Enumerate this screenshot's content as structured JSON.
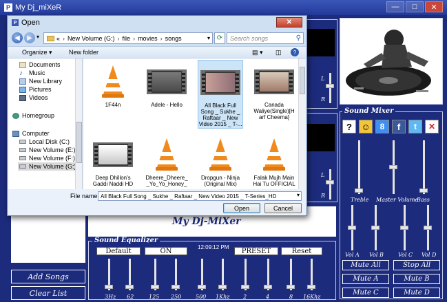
{
  "app": {
    "title": "My Dj_miXeR",
    "icon_letter": "P",
    "brand_text": "My Dj-MiXer"
  },
  "window_buttons": {
    "minimize": "—",
    "maximize": "□",
    "close": "✕"
  },
  "dialog": {
    "title": "Open",
    "icon_letter": "P",
    "close": "✕",
    "breadcrumb": [
      "«",
      "New Volume (G:)",
      "file",
      "movies",
      "songs"
    ],
    "search_placeholder": "Search songs",
    "toolbar": {
      "organize": "Organize ▾",
      "new_folder": "New folder"
    },
    "nav_items": [
      {
        "label": "Documents",
        "icon": "documents-icon"
      },
      {
        "label": "Music",
        "icon": "music-icon"
      },
      {
        "label": "New Library",
        "icon": "library-icon"
      },
      {
        "label": "Pictures",
        "icon": "pictures-icon"
      },
      {
        "label": "Videos",
        "icon": "videos-icon"
      },
      {
        "label": "Homegroup",
        "icon": "homegroup-icon"
      },
      {
        "label": "Computer",
        "icon": "computer-icon"
      },
      {
        "label": "Local Disk (C:)",
        "icon": "drive-icon"
      },
      {
        "label": "New Volume (E:)",
        "icon": "drive-icon"
      },
      {
        "label": "New Volume (F:)",
        "icon": "drive-icon"
      },
      {
        "label": "New Volume (G:)",
        "icon": "drive-icon"
      }
    ],
    "files": [
      {
        "name": "1F44n",
        "kind": "vlc"
      },
      {
        "name": "Adele - Hello",
        "kind": "video"
      },
      {
        "name": "All Black Full Song _ Sukhe _ Raftaar _ New Video 2015 _ T-...",
        "kind": "video"
      },
      {
        "name": "Canada Waliye(Single)[H arf Cheema]",
        "kind": "video"
      },
      {
        "name": "Deep Dhillon's Gaddi Naddi HD",
        "kind": "video"
      },
      {
        "name": "Dheere_Dheere_ _Yo_Yo_Honey_",
        "kind": "vlc"
      },
      {
        "name": "Dropgun - Ninja (Original Mix)",
        "kind": "vlc"
      },
      {
        "name": "Falak Mujh Main Hai Tu OFFICIAL",
        "kind": "vlc"
      }
    ],
    "file_name_label": "File name:",
    "file_name_value": "All Black Full Song _ Sukhe _ Raftaar _ New Video 2015 _ T-Series_HD",
    "open_button": "Open",
    "cancel_button": "Cancel"
  },
  "sound_mixer": {
    "title": "Sound Mixer",
    "labels_top": [
      "Treble",
      "Master Volume",
      "Bass"
    ],
    "labels_bottom": [
      "Vol A",
      "Vol B",
      "Vol C",
      "Vol D"
    ],
    "buttons": [
      "Mute All",
      "Stop All",
      "Mute A",
      "Mute B",
      "Mute C",
      "Mute D"
    ],
    "social_icons": [
      "help-icon",
      "smiley-icon",
      "google-plus-icon",
      "facebook-icon",
      "twitter-icon",
      "close-icon"
    ],
    "social_glyphs": [
      "?",
      "☺",
      "8",
      "f",
      "t",
      "✕"
    ]
  },
  "equalizer": {
    "title": "Sound Equalizer",
    "time": "12:09:12 PM",
    "buttons": [
      "Default",
      "ON",
      "PRESET",
      "Reset"
    ],
    "bands": [
      "3Hz",
      "62",
      "125",
      "250",
      "500",
      "1Khz",
      "2",
      "4",
      "8",
      "16Khz"
    ]
  },
  "playlist": {
    "add_songs": "Add Songs",
    "clear_list": "Clear List"
  },
  "deck": {
    "l_label": "L",
    "r_label": "R"
  }
}
